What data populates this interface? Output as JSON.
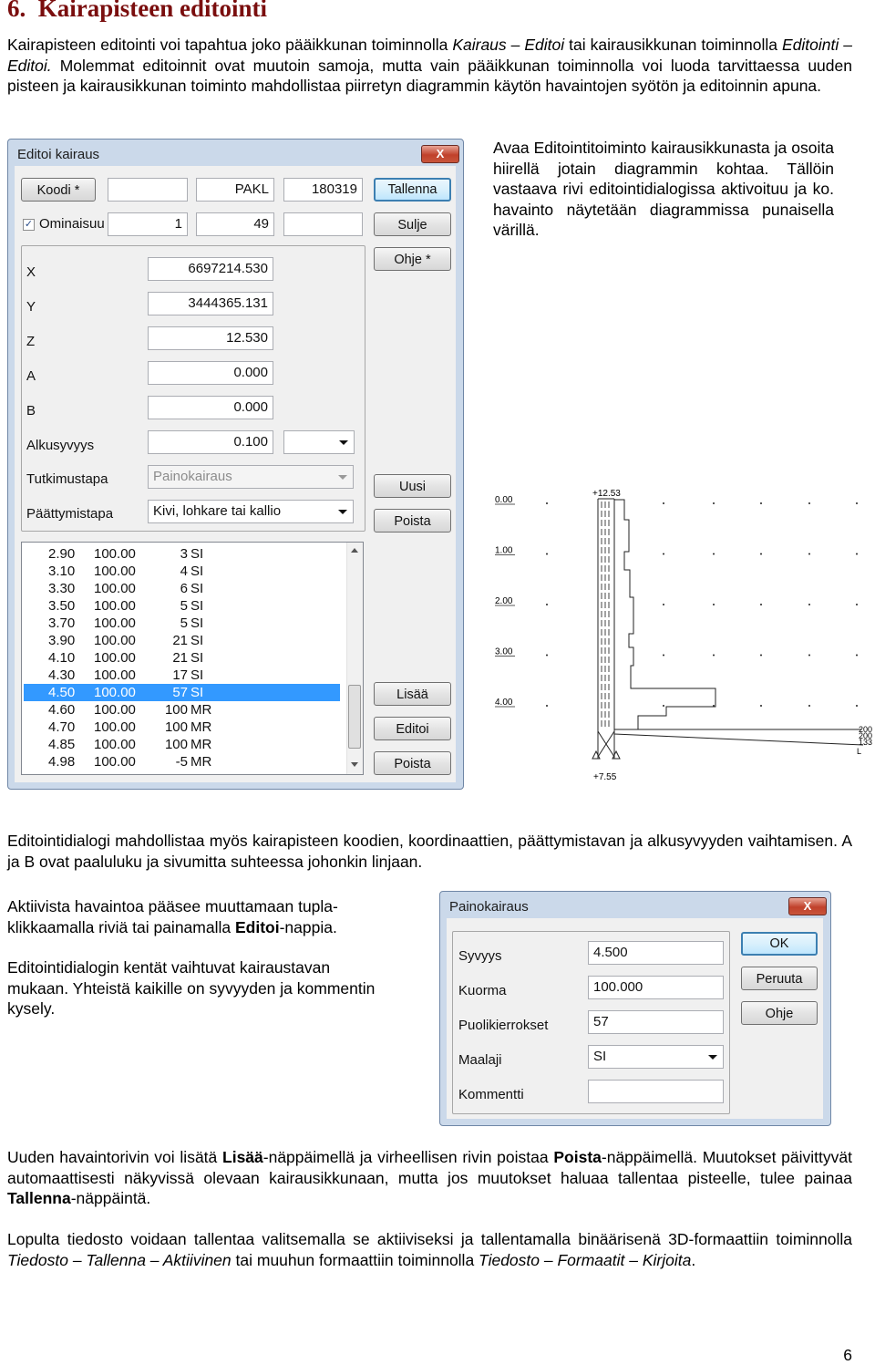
{
  "heading": "6.  Kairapisteen editointi",
  "intro": {
    "t1": "Kairapisteen editointi voi tapahtua joko pääikkunan toiminnolla ",
    "t2": "Kairaus – Editoi",
    "t3": " tai kairausikkunan toiminnolla ",
    "t4": "Editointi – Editoi.",
    "t5": " Molemmat editoinnit ovat muutoin samoja, mutta vain pääikkunan toiminnolla voi luoda tarvittaessa uuden pisteen ja kairausikkunan toiminto mahdollistaa piirretyn diagrammin käytön havaintojen syötön ja editoinnin apuna."
  },
  "side_text": "Avaa Editointitoiminto kairausikkunasta ja osoita hiirellä jotain diagrammin kohtaa. Tällöin vastaava rivi editointidialogissa aktivoituu ja ko. havainto näytetään diagrammissa punaisella värillä.",
  "edit_dialog": {
    "title": "Editoi kairaus",
    "close": "X",
    "koodi_btn": "Koodi *",
    "code_field2": "PAKL",
    "code_field3": "180319",
    "ominaisuus_label": "Ominaisuu",
    "ominaisuus_checked": "✓",
    "prop_field1": "1",
    "prop_field2": "49",
    "fields": [
      {
        "label": "X",
        "value": "6697214.530"
      },
      {
        "label": "Y",
        "value": "3444365.131"
      },
      {
        "label": "Z",
        "value": "12.530"
      },
      {
        "label": "A",
        "value": "0.000"
      },
      {
        "label": "B",
        "value": "0.000"
      },
      {
        "label": "Alkusyvyys",
        "value": "0.100"
      }
    ],
    "tutkimustapa_label": "Tutkimustapa",
    "tutkimustapa_value": "Painokairaus",
    "paattymistapa_label": "Päättymistapa",
    "paattymistapa_value": "Kivi, lohkare tai kallio",
    "buttons": {
      "tallenna": "Tallenna",
      "sulje": "Sulje",
      "ohje": "Ohje *",
      "uusi": "Uusi",
      "poista1": "Poista",
      "lisaa": "Lisää",
      "editoi": "Editoi",
      "poista2": "Poista"
    },
    "rows": [
      {
        "depth": "2.90",
        "load": "100.00",
        "count": "3",
        "type": "SI"
      },
      {
        "depth": "3.10",
        "load": "100.00",
        "count": "4",
        "type": "SI"
      },
      {
        "depth": "3.30",
        "load": "100.00",
        "count": "6",
        "type": "SI"
      },
      {
        "depth": "3.50",
        "load": "100.00",
        "count": "5",
        "type": "SI"
      },
      {
        "depth": "3.70",
        "load": "100.00",
        "count": "5",
        "type": "SI"
      },
      {
        "depth": "3.90",
        "load": "100.00",
        "count": "21",
        "type": "SI"
      },
      {
        "depth": "4.10",
        "load": "100.00",
        "count": "21",
        "type": "SI"
      },
      {
        "depth": "4.30",
        "load": "100.00",
        "count": "17",
        "type": "SI"
      },
      {
        "depth": "4.50",
        "load": "100.00",
        "count": "57",
        "type": "SI"
      },
      {
        "depth": "4.60",
        "load": "100.00",
        "count": "100",
        "type": "MR"
      },
      {
        "depth": "4.70",
        "load": "100.00",
        "count": "100",
        "type": "MR"
      },
      {
        "depth": "4.85",
        "load": "100.00",
        "count": "100",
        "type": "MR"
      },
      {
        "depth": "4.98",
        "load": "100.00",
        "count": "-5",
        "type": "MR"
      }
    ],
    "selected_row": 8
  },
  "diagram": {
    "depth_labels": [
      "0.00",
      "1.00",
      "2.00",
      "3.00",
      "4.00"
    ],
    "top_label": "+12.53",
    "bottom_label": "+7.55",
    "end_labels": [
      "200",
      "200",
      "133"
    ]
  },
  "after_diagram": "Editointidialogi mahdollistaa myös kairapisteen koodien, koordinaattien, päättymistavan ja alkusyvyyden vaihtamisen. A ja B ovat paaluluku ja sivumitta suhteessa johonkin linjaan.",
  "left_col": {
    "p1a": "Aktiivista havaintoa pääsee muuttamaan tupla-klikkaamalla riviä tai painamalla ",
    "p1b": "Editoi",
    "p1c": "-nappia.",
    "p2": "Editointidialogin kentät vaihtuvat kairaustavan mukaan. Yhteistä kaikille on syvyyden ja kommentin kysely."
  },
  "paino_dialog": {
    "title": "Painokairaus",
    "close": "X",
    "fields": [
      {
        "label": "Syvyys",
        "value": "4.500"
      },
      {
        "label": "Kuorma",
        "value": "100.000"
      },
      {
        "label": "Puolikierrokset",
        "value": "57"
      },
      {
        "label": "Maalaji",
        "value": "SI"
      },
      {
        "label": "Kommentti",
        "value": ""
      }
    ],
    "buttons": {
      "ok": "OK",
      "peruuta": "Peruuta",
      "ohje": "Ohje"
    }
  },
  "p_add": {
    "a": "Uuden havaintorivin voi lisätä ",
    "b": "Lisää",
    "c": "-näppäimellä ja virheellisen rivin poistaa ",
    "d": "Poista",
    "e": "-näppäimellä. Muutokset päivittyvät automaattisesti näkyvissä olevaan kairausikkunaan, mutta jos muutokset haluaa tallentaa pisteelle, tulee painaa ",
    "f": "Tallenna",
    "g": "-näppäintä."
  },
  "p_save": {
    "a": "Lopulta tiedosto voidaan tallentaa valitsemalla se aktiiviseksi ja tallentamalla binäärisenä 3D-formaattiin toiminnolla ",
    "b": "Tiedosto – Tallenna – Aktiivinen",
    "c": " tai muuhun formaattiin toiminnolla ",
    "d": "Tiedosto – Formaatit – Kirjoita",
    "e": "."
  },
  "page_number": "6"
}
